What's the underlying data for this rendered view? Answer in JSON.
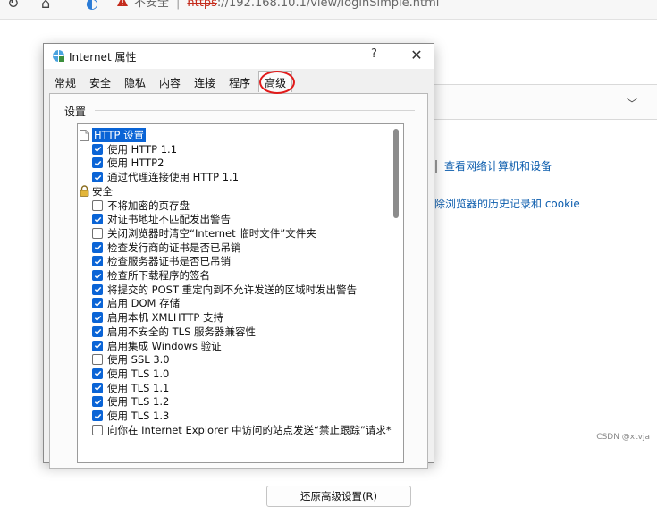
{
  "browser": {
    "address_warning": "不安全",
    "address_scheme": "https",
    "address_rest": "://192.168.10.1/view/loginSimple.html"
  },
  "background_page": {
    "link_1": "查看网络计算机和设备",
    "link_2": "除浏览器的历史记录和 cookie"
  },
  "watermark": "CSDN @xtvja",
  "dialog": {
    "title": "Internet 属性",
    "help_label": "?",
    "close_label": "✕",
    "tabs": [
      {
        "label": "常规"
      },
      {
        "label": "安全"
      },
      {
        "label": "隐私"
      },
      {
        "label": "内容"
      },
      {
        "label": "连接"
      },
      {
        "label": "程序"
      },
      {
        "label": "高级"
      }
    ],
    "active_tab": "高级",
    "group_label": "设置",
    "restore_button": "还原高级设置(R)",
    "settings": [
      {
        "type": "category",
        "label": "HTTP 设置",
        "icon": "page-icon",
        "selected": true
      },
      {
        "type": "option",
        "label": "使用 HTTP 1.1",
        "checked": true
      },
      {
        "type": "option",
        "label": "使用 HTTP2",
        "checked": true
      },
      {
        "type": "option",
        "label": "通过代理连接使用 HTTP 1.1",
        "checked": true
      },
      {
        "type": "category",
        "label": "安全",
        "icon": "lock-icon",
        "selected": false
      },
      {
        "type": "option",
        "label": "不将加密的页存盘",
        "checked": false
      },
      {
        "type": "option",
        "label": "对证书地址不匹配发出警告",
        "checked": true
      },
      {
        "type": "option",
        "label": "关闭浏览器时清空“Internet 临时文件”文件夹",
        "checked": false
      },
      {
        "type": "option",
        "label": "检查发行商的证书是否已吊销",
        "checked": true
      },
      {
        "type": "option",
        "label": "检查服务器证书是否已吊销",
        "checked": true
      },
      {
        "type": "option",
        "label": "检查所下载程序的签名",
        "checked": true
      },
      {
        "type": "option",
        "label": "将提交的 POST 重定向到不允许发送的区域时发出警告",
        "checked": true
      },
      {
        "type": "option",
        "label": "启用 DOM 存储",
        "checked": true
      },
      {
        "type": "option",
        "label": "启用本机 XMLHTTP 支持",
        "checked": true
      },
      {
        "type": "option",
        "label": "启用不安全的 TLS 服务器兼容性",
        "checked": true
      },
      {
        "type": "option",
        "label": "启用集成 Windows 验证",
        "checked": true
      },
      {
        "type": "option",
        "label": "使用 SSL 3.0",
        "checked": false
      },
      {
        "type": "option",
        "label": "使用 TLS 1.0",
        "checked": true
      },
      {
        "type": "option",
        "label": "使用 TLS 1.1",
        "checked": true
      },
      {
        "type": "option",
        "label": "使用 TLS 1.2",
        "checked": true
      },
      {
        "type": "option",
        "label": "使用 TLS 1.3",
        "checked": true
      },
      {
        "type": "option",
        "label": "向你在 Internet Explorer 中访问的站点发送“禁止跟踪”请求*",
        "checked": false
      }
    ]
  }
}
